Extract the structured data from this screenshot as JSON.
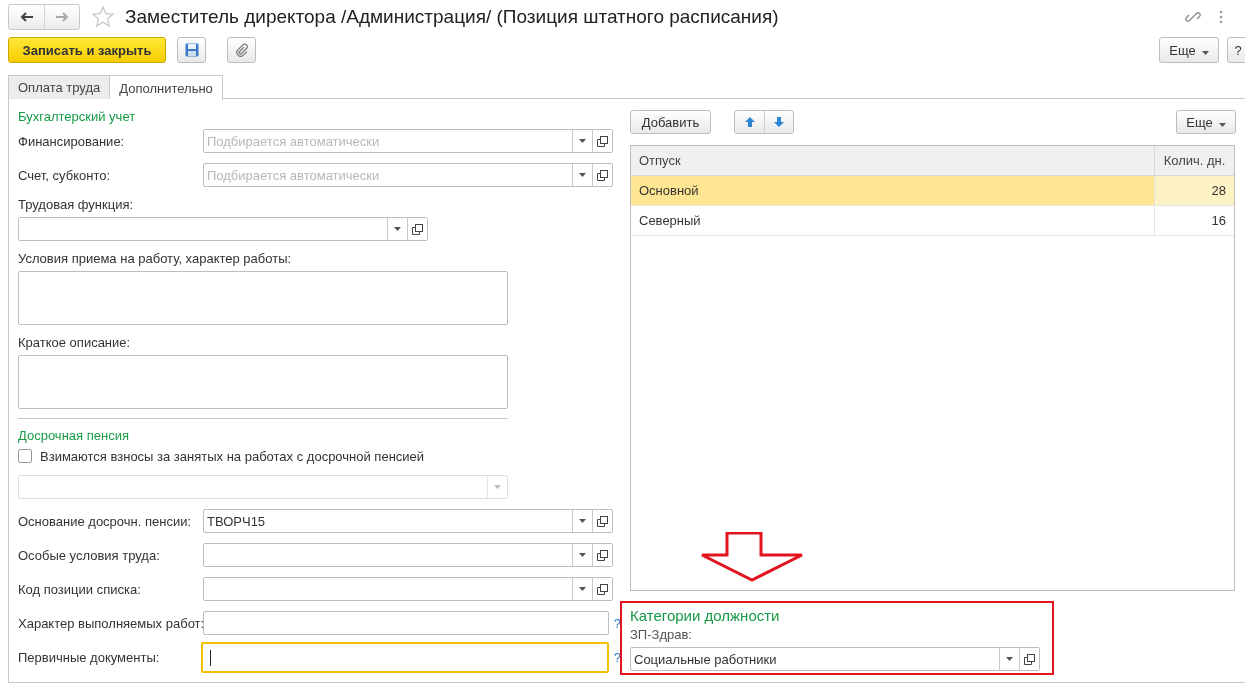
{
  "window": {
    "title": "Заместитель директора /Администрация/ (Позиция штатного расписания)"
  },
  "toolbar": {
    "primary_button": "Записать и закрыть",
    "more_button": "Еще",
    "help_button": "?"
  },
  "tabs": [
    {
      "label": "Оплата труда",
      "selected": false
    },
    {
      "label": "Дополнительно",
      "selected": true
    }
  ],
  "left_items": [
    {
      "kind": "section",
      "title": "Бухгалтерский учет",
      "rule": false
    },
    {
      "kind": "combo",
      "label": "Финансирование:",
      "placeholder": "Подбирается автоматически",
      "disabled": false
    },
    {
      "kind": "combo",
      "label": "Счет, субконто:",
      "placeholder": "Подбирается автоматически",
      "disabled": false
    },
    {
      "kind": "combo_stacked",
      "label": "Трудовая функция:",
      "disabled": false
    },
    {
      "kind": "memo",
      "label": "Условия приема на работу, характер работы:"
    },
    {
      "kind": "memo",
      "label": "Краткое описание:"
    },
    {
      "kind": "section",
      "title": "Досрочная пенсия",
      "rule": true
    },
    {
      "kind": "checkbox",
      "label": "Взимаются взносы за занятых на работах с досрочной пенсией",
      "checked": false
    },
    {
      "kind": "combo_stacked",
      "disabled": true
    },
    {
      "kind": "combo",
      "label": "Основание досрочн. пенсии:",
      "value": "ТВОРЧ15",
      "disabled": false
    },
    {
      "kind": "combo",
      "label": "Особые условия труда:",
      "disabled": false
    },
    {
      "kind": "combo",
      "label": "Код позиции списка:",
      "disabled": false
    },
    {
      "kind": "input",
      "label": "Характер выполняемых работ:",
      "focused": false,
      "help": "?"
    },
    {
      "kind": "input",
      "label": "Первичные документы:",
      "focused": true,
      "help": "?"
    }
  ],
  "table_toolbar": {
    "add_button": "Добавить",
    "more_button": "Еще"
  },
  "table": {
    "columns": [
      "Отпуск",
      "Колич. дн."
    ],
    "rows": [
      {
        "cells": [
          "Основной",
          "28"
        ],
        "selected": true
      },
      {
        "cells": [
          "Северный",
          "16"
        ],
        "selected": false
      }
    ]
  },
  "categories": {
    "title": "Категории должности",
    "field_label": "ЗП-Здрав:",
    "value": "Социальные работники"
  }
}
